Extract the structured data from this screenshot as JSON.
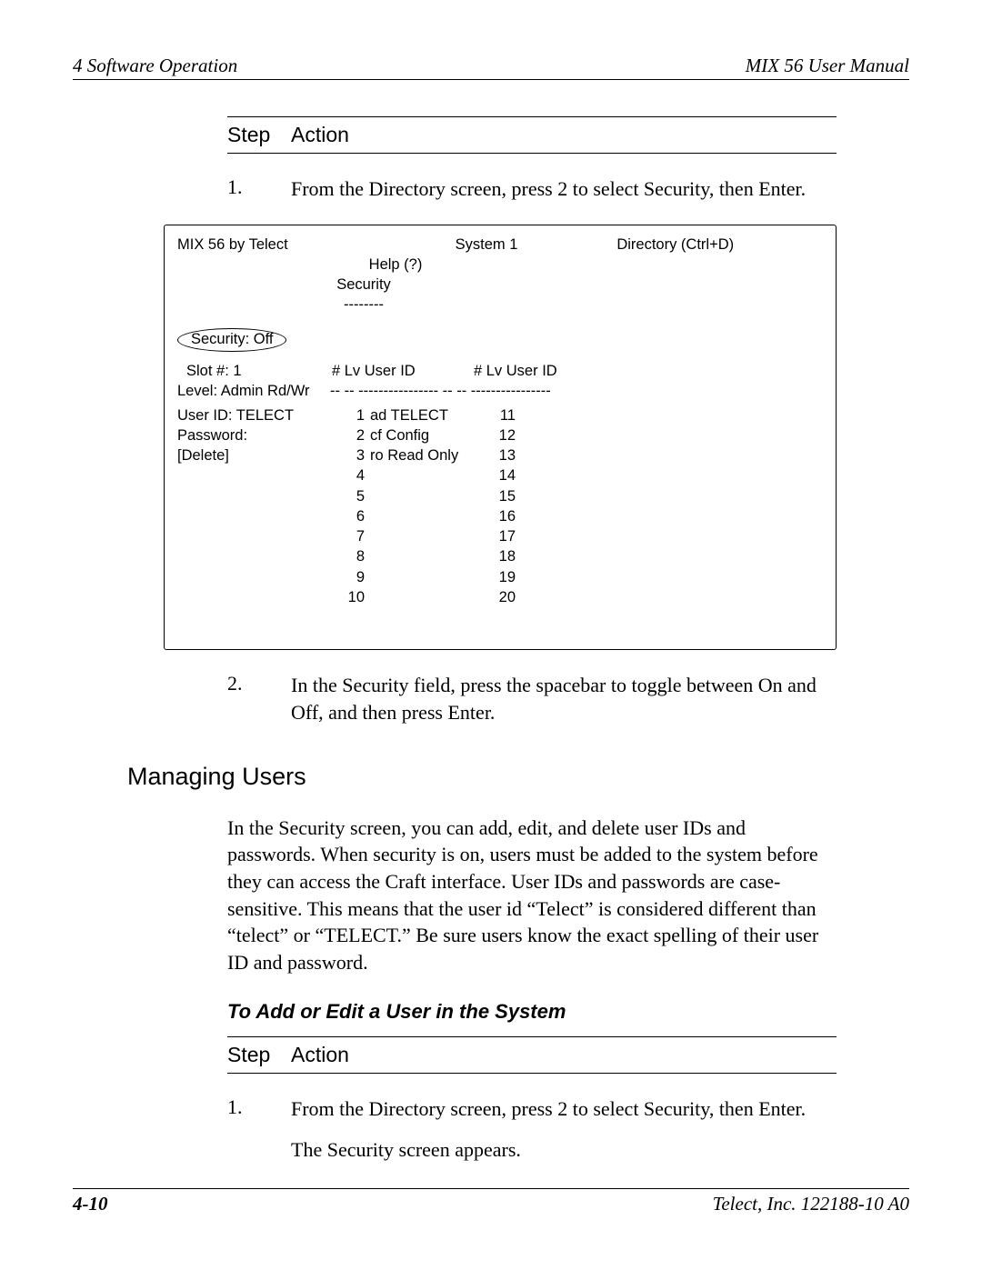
{
  "header": {
    "left": "4  Software Operation",
    "right": "MIX 56 User Manual"
  },
  "table1": {
    "hdr_step": "Step",
    "hdr_action": "Action",
    "rows": [
      {
        "num": "1.",
        "text": "From the Directory screen, press 2 to select Security, then Enter."
      },
      {
        "num": "2.",
        "text": "In the Security field, press the spacebar to toggle between On and Off, and then press Enter."
      }
    ]
  },
  "terminal": {
    "top_left": "MIX 56 by Telect",
    "top_mid": "System 1",
    "top_right": "Directory (Ctrl+D)",
    "help": "Help (?)",
    "title": "Security",
    "title_ul": "--------",
    "security_label": "Security: Off",
    "head_slot": "Slot #: 1",
    "head_col": "#  Lv User ID",
    "level_label": " Level: Admin Rd/Wr",
    "sep_line": "-- -- ----------------    -- -- ----------------",
    "rows": [
      {
        "c0": "User ID: TELECT",
        "c1": "1",
        "c2": "ad TELECT",
        "c3": "11",
        "c4": ""
      },
      {
        "c0": "Password:",
        "c1": "2",
        "c2": "cf Config",
        "c3": "12",
        "c4": ""
      },
      {
        "c0": "[Delete]",
        "c1": "3",
        "c2": "ro Read Only",
        "c3": "13",
        "c4": ""
      },
      {
        "c0": "",
        "c1": "4",
        "c2": "",
        "c3": "14",
        "c4": ""
      },
      {
        "c0": "",
        "c1": "5",
        "c2": "",
        "c3": "15",
        "c4": ""
      },
      {
        "c0": "",
        "c1": "6",
        "c2": "",
        "c3": "16",
        "c4": ""
      },
      {
        "c0": "",
        "c1": "7",
        "c2": "",
        "c3": "17",
        "c4": ""
      },
      {
        "c0": "",
        "c1": "8",
        "c2": "",
        "c3": "18",
        "c4": ""
      },
      {
        "c0": "",
        "c1": "9",
        "c2": "",
        "c3": "19",
        "c4": ""
      },
      {
        "c0": "",
        "c1": "10",
        "c2": "",
        "c3": "20",
        "c4": ""
      }
    ]
  },
  "section_heading": "Managing Users",
  "para1": "In the Security screen, you can add, edit, and delete user IDs and passwords. When security is on, users must be added to the system before they can access the Craft interface. User IDs and passwords are case-sensitive. This means that the user id “Telect” is considered different than “telect” or “TELECT.” Be sure users know the exact spelling of their user ID and password.",
  "sub_heading": "To Add or Edit a User in the System",
  "table2": {
    "hdr_step": "Step",
    "hdr_action": "Action",
    "rows": [
      {
        "num": "1.",
        "text": "From the Directory screen, press 2 to select Security, then Enter."
      }
    ],
    "extra": "The Security screen appears."
  },
  "footer": {
    "page": "4-10",
    "right": "Telect, Inc.  122188-10 A0"
  }
}
